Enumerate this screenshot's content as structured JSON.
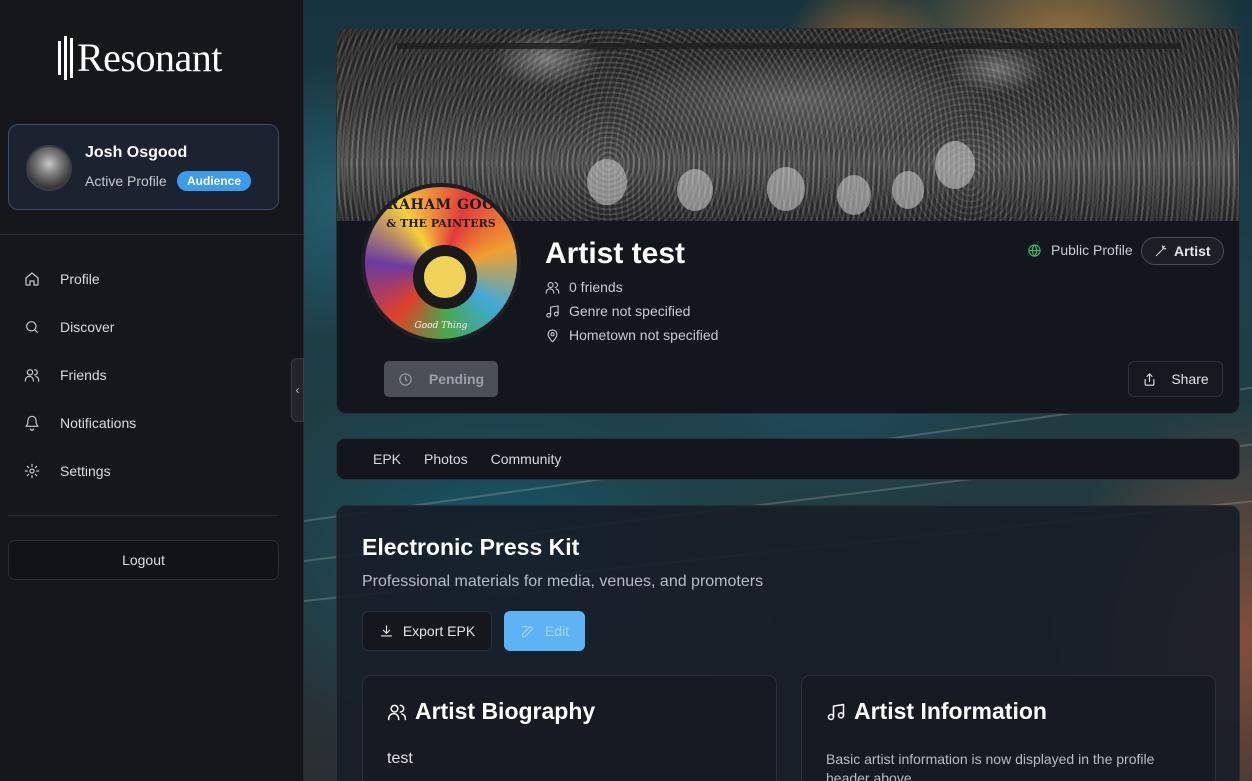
{
  "app": {
    "logo_text": "Resonant"
  },
  "sidebar": {
    "profile": {
      "name": "Josh Osgood",
      "status": "Active Profile",
      "badge": "Audience"
    },
    "items": [
      {
        "label": "Profile",
        "icon": "home-icon"
      },
      {
        "label": "Discover",
        "icon": "search-icon"
      },
      {
        "label": "Friends",
        "icon": "users-icon"
      },
      {
        "label": "Notifications",
        "icon": "bell-icon"
      },
      {
        "label": "Settings",
        "icon": "gear-icon"
      }
    ],
    "logout_label": "Logout",
    "collapse_glyph": "‹"
  },
  "artist": {
    "name": "Artist test",
    "friends": "0 friends",
    "genre": "Genre not specified",
    "hometown": "Hometown not specified",
    "visibility": "Public Profile",
    "type_badge": "Artist",
    "pending_label": "Pending",
    "share_label": "Share",
    "avatar_logo": {
      "line1": "GRAHAM GOOD",
      "line2": "& THE PAINTERS",
      "line3": "Good Thing"
    }
  },
  "tabs": [
    {
      "label": "EPK"
    },
    {
      "label": "Photos"
    },
    {
      "label": "Community"
    }
  ],
  "epk": {
    "title": "Electronic Press Kit",
    "subtitle": "Professional materials for media, venues, and promoters",
    "export_label": "Export EPK",
    "edit_label": "Edit",
    "biography": {
      "title": "Artist Biography",
      "text": "test"
    },
    "information": {
      "title": "Artist Information",
      "text": "Basic artist information is now displayed in the profile header above"
    }
  },
  "colors": {
    "accent": "#3d9be9",
    "edit_button": "#5db3f3",
    "public_globe": "#2fbe6a",
    "sidebar_bg": "#16171a",
    "card_bg": "#13161d"
  }
}
